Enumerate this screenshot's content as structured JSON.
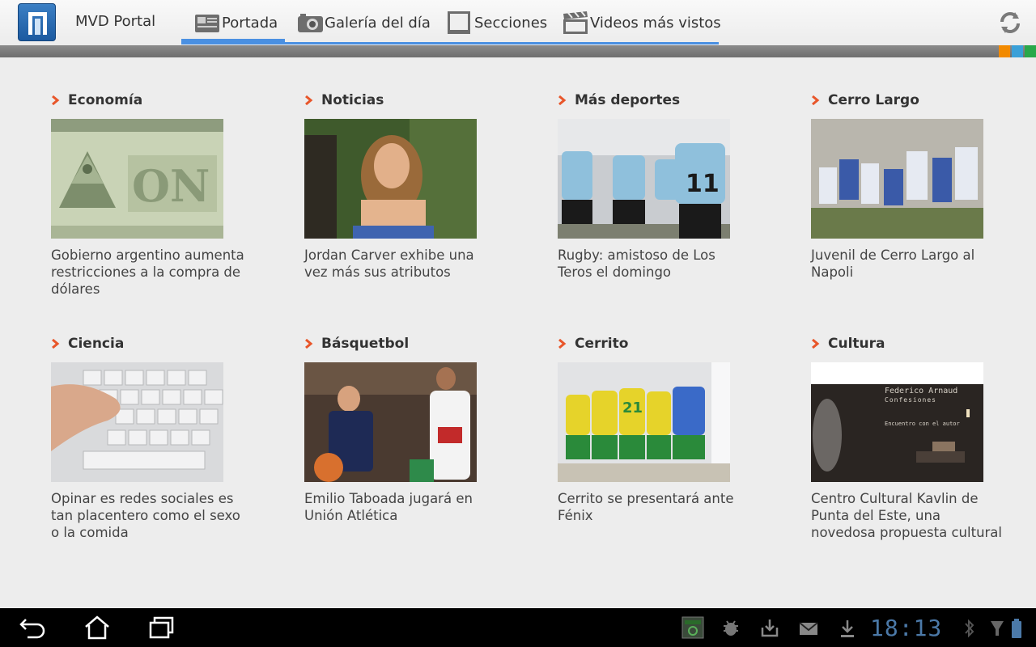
{
  "app": {
    "title": "MVD Portal",
    "logo_icon": "mvd-portal-logo-icon"
  },
  "tabs": [
    {
      "label": "Portada",
      "icon": "newspaper-icon",
      "active": true
    },
    {
      "label": "Galería del día",
      "icon": "camera-icon",
      "active": false
    },
    {
      "label": "Secciones",
      "icon": "sections-icon",
      "active": false
    },
    {
      "label": "Videos más vistos",
      "icon": "clapperboard-icon",
      "active": false
    }
  ],
  "colors": {
    "accent_blue": "#4a90e2",
    "chevron_orange": "#e8562a",
    "color_squares": [
      "#f28a00",
      "#3aa0d8",
      "#2aa84a"
    ]
  },
  "cards": [
    {
      "section": "Economía",
      "headline": "Gobierno argentino aumenta restricciones a la compra de dólares",
      "image": "dollar-bill"
    },
    {
      "section": "Noticias",
      "headline": "Jordan Carver exhibe una vez más sus atributos",
      "image": "woman-portrait"
    },
    {
      "section": "Más deportes",
      "headline": "Rugby: amistoso de Los Teros el domingo",
      "image": "rugby-players"
    },
    {
      "section": "Cerro Largo",
      "headline": "Juvenil de Cerro Largo al Napoli",
      "image": "football-celebration"
    },
    {
      "section": "Ciencia",
      "headline": "Opinar es redes sociales es tan placentero como el sexo o la comida",
      "image": "keyboard-hand"
    },
    {
      "section": "Básquetbol",
      "headline": "Emilio Taboada jugará en Unión Atlética",
      "image": "basketball-players"
    },
    {
      "section": "Cerrito",
      "headline": "Cerrito se presentará ante Fénix",
      "image": "team-huddle"
    },
    {
      "section": "Cultura",
      "headline": "Centro Cultural Kavlin de Punta del Este, una novedosa propuesta cultural",
      "image": "exhibition-poster"
    }
  ],
  "poster": {
    "line1": "Federico Arnaud",
    "line2": "Confesiones",
    "line3": "Encuentro con el autor"
  },
  "system": {
    "clock": "18:13"
  }
}
